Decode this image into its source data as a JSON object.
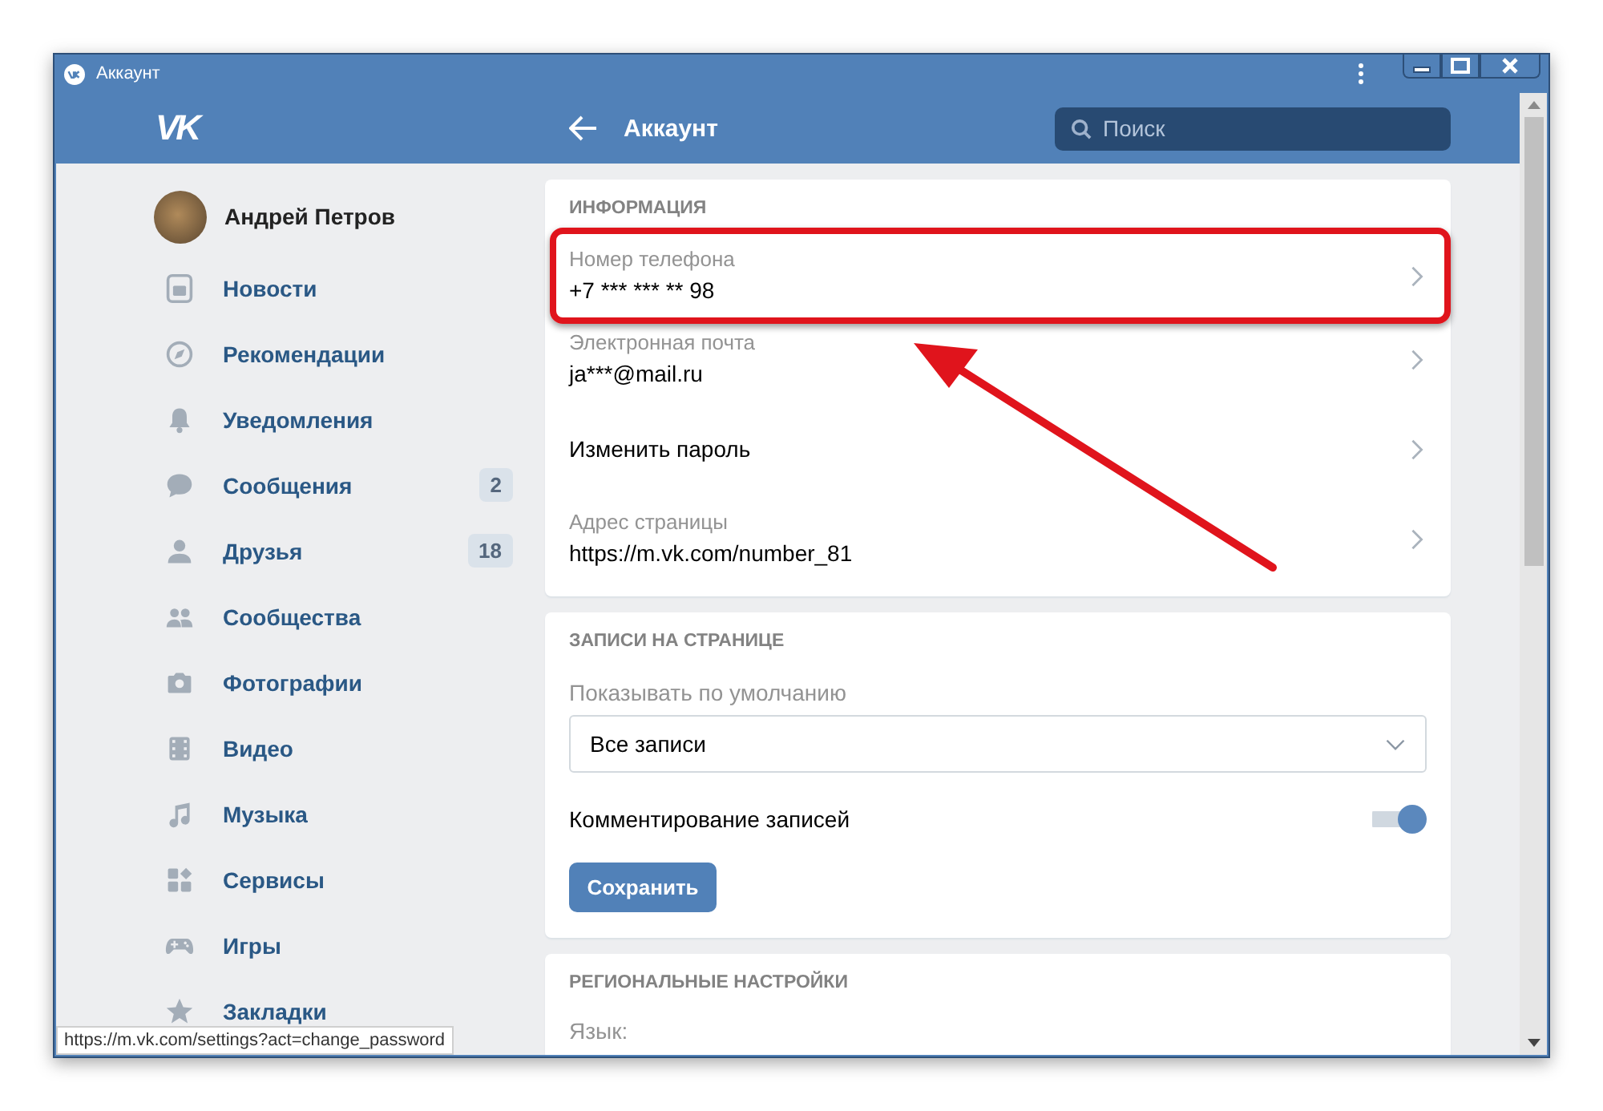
{
  "window": {
    "title": "Аккаунт"
  },
  "header": {
    "logo": "VK",
    "title": "Аккаунт",
    "search": {
      "placeholder": "Поиск"
    }
  },
  "sidebar": {
    "profile": {
      "name": "Андрей Петров"
    },
    "items": [
      {
        "label": "Новости"
      },
      {
        "label": "Рекомендации"
      },
      {
        "label": "Уведомления"
      },
      {
        "label": "Сообщения",
        "badge": "2"
      },
      {
        "label": "Друзья",
        "badge": "18"
      },
      {
        "label": "Сообщества"
      },
      {
        "label": "Фотографии"
      },
      {
        "label": "Видео"
      },
      {
        "label": "Музыка"
      },
      {
        "label": "Сервисы"
      },
      {
        "label": "Игры"
      },
      {
        "label": "Закладки"
      }
    ]
  },
  "sections": [
    {
      "title": "ИНФОРМАЦИЯ",
      "items": [
        {
          "kind": "field",
          "label": "Номер телефона",
          "value": "+7 *** *** ** 98",
          "highlighted": true
        },
        {
          "kind": "field",
          "label": "Электронная почта",
          "value": "ja***@mail.ru",
          "highlighted": false
        },
        {
          "kind": "action",
          "label": "Изменить пароль",
          "highlighted": false
        },
        {
          "kind": "field",
          "label": "Адрес страницы",
          "value": "https://m.vk.com/number_81",
          "highlighted": false
        }
      ]
    },
    {
      "title": "ЗАПИСИ НА СТРАНИЦЕ",
      "items": [
        {
          "kind": "select",
          "label": "Показывать по умолчанию",
          "value": "Все записи"
        },
        {
          "kind": "toggle",
          "label": "Комментирование записей",
          "on": true
        },
        {
          "kind": "button",
          "label": "Сохранить"
        }
      ]
    },
    {
      "title": "РЕГИОНАЛЬНЫЕ НАСТРОЙКИ",
      "items": [
        {
          "kind": "caption",
          "label": "Язык:"
        }
      ]
    }
  ],
  "status_bar": {
    "url": "https://m.vk.com/settings?act=change_password"
  }
}
